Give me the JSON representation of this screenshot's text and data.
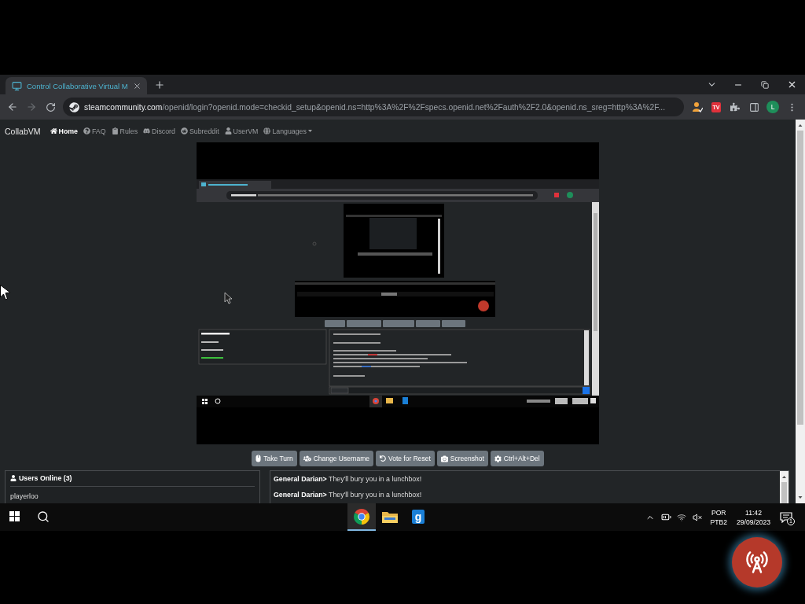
{
  "browser": {
    "tabs": [
      {
        "title": "Control Collaborative Virtual M",
        "selected": true
      }
    ],
    "address": {
      "host": "steamcommunity.com",
      "rest": "/openid/login?openid.mode=checkid_setup&openid.ns=http%3A%2F%2Fspecs.openid.net%2Fauth%2F2.0&openid.ns_sreg=http%3A%2F..."
    },
    "extension_badge": "TV",
    "profile_initial": "L"
  },
  "navbar": {
    "brand": "CollabVM",
    "items": [
      {
        "label": "Home",
        "selected": true,
        "dropdown": false
      },
      {
        "label": "FAQ",
        "selected": false,
        "dropdown": false
      },
      {
        "label": "Rules",
        "selected": false,
        "dropdown": false
      },
      {
        "label": "Discord",
        "selected": false,
        "dropdown": false
      },
      {
        "label": "Subreddit",
        "selected": false,
        "dropdown": false
      },
      {
        "label": "UserVM",
        "selected": false,
        "dropdown": false
      },
      {
        "label": "Languages",
        "selected": false,
        "dropdown": true
      }
    ]
  },
  "vm_controls": [
    "Take Turn",
    "Change Username",
    "Vote for Reset",
    "Screenshot",
    "Ctrl+Alt+Del"
  ],
  "users_panel": {
    "title": "Users Online (3)",
    "users": [
      "playerloo"
    ]
  },
  "chat": {
    "messages": [
      "**General Darian>** They'll bury you in a lunchbox!",
      "**General Darian>** They'll bury you in a lunchbox!"
    ]
  },
  "taskbar": {
    "apps": [
      {
        "kind": "browser",
        "active": true
      },
      {
        "kind": "folder",
        "active": false
      },
      {
        "kind": "letter",
        "letter": "g",
        "active": false
      }
    ],
    "tray": {
      "language": "POR",
      "layout": "PTB2",
      "time": "11:42",
      "date": "29/09/2023",
      "notifications": "1"
    }
  }
}
